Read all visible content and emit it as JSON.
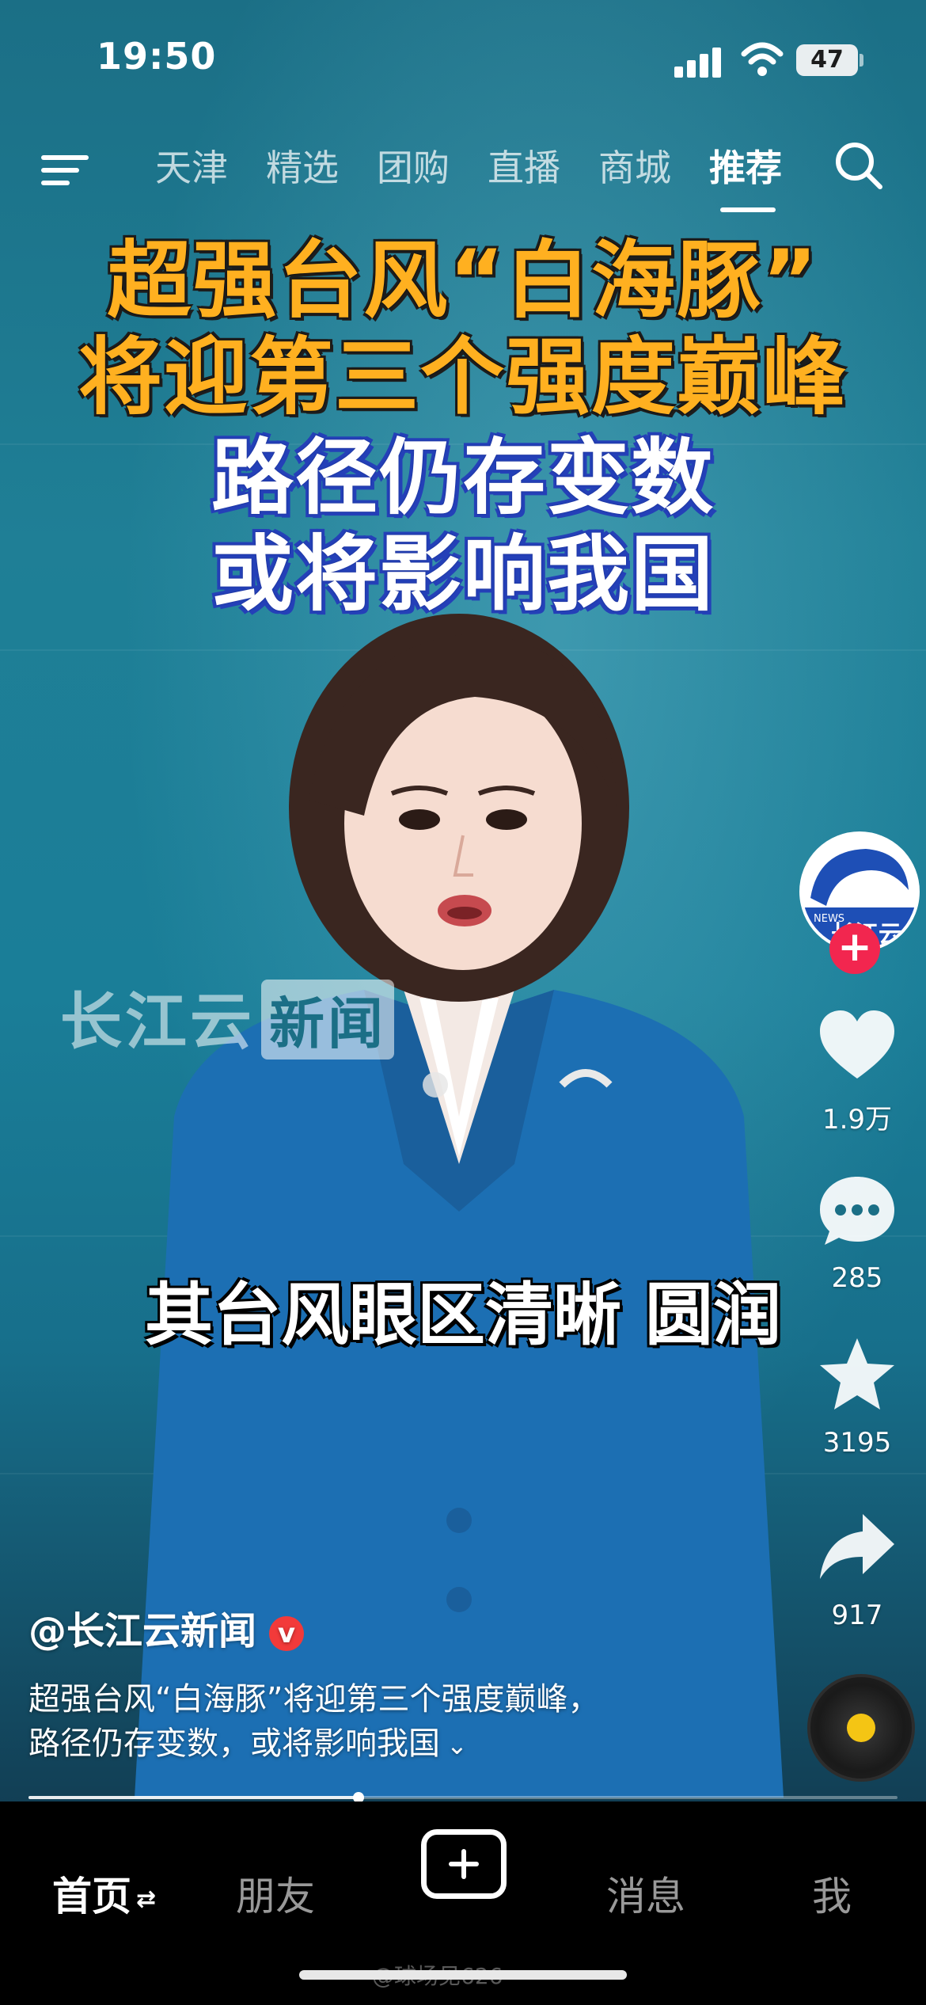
{
  "status_bar": {
    "time": "19:50",
    "battery": "47"
  },
  "top_nav": {
    "tabs": [
      {
        "label": "天津"
      },
      {
        "label": "精选"
      },
      {
        "label": "团购"
      },
      {
        "label": "直播"
      },
      {
        "label": "商城"
      },
      {
        "label": "推荐"
      }
    ],
    "active_tab": "推荐"
  },
  "video": {
    "headline_line1": "超强台风“白海豚”",
    "headline_line2": "将迎第三个强度巅峰",
    "headline_line3": "路径仍存变数",
    "headline_line4": "或将影响我国",
    "watermark_main": "长江云",
    "watermark_tag": "新闻",
    "subtitle": "其台风眼区清晰  圆润"
  },
  "right_rail": {
    "avatar_text": "长江云",
    "avatar_news": "NEWS",
    "likes": "1.9万",
    "comments": "285",
    "favorites": "3195",
    "shares": "917"
  },
  "post": {
    "author": "@长江云新闻",
    "caption_line1": "超强台风“白海豚”将迎第三个强度巅峰，",
    "caption_line2": "路径仍存变数，或将影响我国",
    "progress": 0.38
  },
  "bottom_nav": {
    "home": "首页",
    "friends": "朋友",
    "messages": "消息",
    "me": "我"
  },
  "watermark": "@球场见626",
  "colors": {
    "headline_orange": "#ffb020",
    "headline_blue_outline": "#2440b8",
    "follow_red": "#f2264f"
  }
}
